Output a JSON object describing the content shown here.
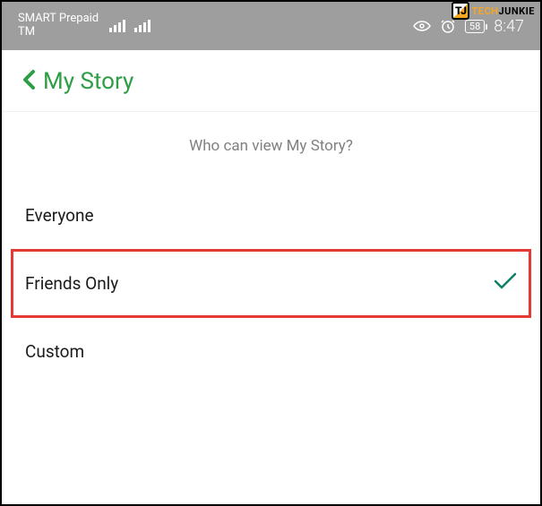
{
  "watermark": {
    "logo_text": "TJ",
    "brand_first": "TECH",
    "brand_second": "JUNKIE"
  },
  "status_bar": {
    "carrier_line1": "SMART Prepaid",
    "carrier_line2": "TM",
    "battery": "58",
    "time": "8:47"
  },
  "header": {
    "title": "My Story"
  },
  "subtitle": "Who can view My Story?",
  "options": [
    {
      "label": "Everyone",
      "selected": false,
      "highlighted": false
    },
    {
      "label": "Friends Only",
      "selected": true,
      "highlighted": true
    },
    {
      "label": "Custom",
      "selected": false,
      "highlighted": false
    }
  ],
  "colors": {
    "accent": "#2e9e46",
    "highlight_border": "#e53935",
    "checkmark": "#0d8066",
    "status_bg": "#9e9e9e"
  }
}
